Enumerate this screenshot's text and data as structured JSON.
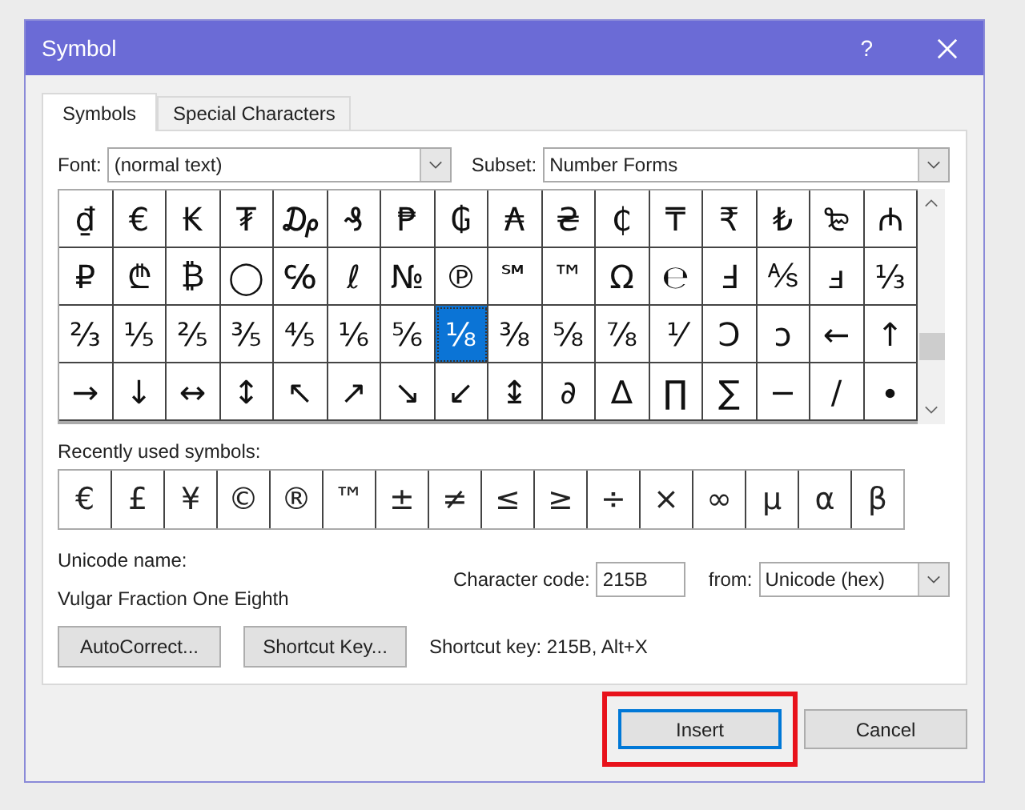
{
  "window": {
    "title": "Symbol",
    "help": "?"
  },
  "tabs": [
    {
      "label": "Symbols",
      "selected": true
    },
    {
      "label": "Special Characters",
      "selected": false
    }
  ],
  "font": {
    "label": "Font:",
    "value": "(normal text)"
  },
  "subset": {
    "label": "Subset:",
    "value": "Number Forms"
  },
  "symbols": [
    [
      {
        "char": "₫",
        "selected": false
      },
      {
        "char": "€",
        "selected": false
      },
      {
        "char": "₭",
        "selected": false
      },
      {
        "char": "₮",
        "selected": false
      },
      {
        "char": "₯",
        "selected": false
      },
      {
        "char": "₰",
        "selected": false
      },
      {
        "char": "₱",
        "selected": false
      },
      {
        "char": "₲",
        "selected": false
      },
      {
        "char": "₳",
        "selected": false
      },
      {
        "char": "₴",
        "selected": false
      },
      {
        "char": "₵",
        "selected": false
      },
      {
        "char": "₸",
        "selected": false
      },
      {
        "char": "₹",
        "selected": false
      },
      {
        "char": "₺",
        "selected": false
      },
      {
        "char": "₻",
        "selected": false
      },
      {
        "char": "₼",
        "selected": false
      }
    ],
    [
      {
        "char": "₽",
        "selected": false
      },
      {
        "char": "₾",
        "selected": false
      },
      {
        "char": "₿",
        "selected": false
      },
      {
        "char": "◯",
        "selected": false
      },
      {
        "char": "℅",
        "selected": false
      },
      {
        "char": "ℓ",
        "selected": false
      },
      {
        "char": "№",
        "selected": false
      },
      {
        "char": "℗",
        "selected": false
      },
      {
        "char": "℠",
        "selected": false
      },
      {
        "char": "™",
        "selected": false
      },
      {
        "char": "Ω",
        "selected": false
      },
      {
        "char": "℮",
        "selected": false
      },
      {
        "char": "Ⅎ",
        "selected": false
      },
      {
        "char": "⅍",
        "selected": false
      },
      {
        "char": "ⅎ",
        "selected": false
      },
      {
        "char": "⅓",
        "selected": false
      }
    ],
    [
      {
        "char": "⅔",
        "selected": false
      },
      {
        "char": "⅕",
        "selected": false
      },
      {
        "char": "⅖",
        "selected": false
      },
      {
        "char": "⅗",
        "selected": false
      },
      {
        "char": "⅘",
        "selected": false
      },
      {
        "char": "⅙",
        "selected": false
      },
      {
        "char": "⅚",
        "selected": false
      },
      {
        "char": "⅛",
        "selected": true
      },
      {
        "char": "⅜",
        "selected": false
      },
      {
        "char": "⅝",
        "selected": false
      },
      {
        "char": "⅞",
        "selected": false
      },
      {
        "char": "⅟",
        "selected": false
      },
      {
        "char": "Ↄ",
        "selected": false
      },
      {
        "char": "ↄ",
        "selected": false
      },
      {
        "char": "←",
        "selected": false
      },
      {
        "char": "↑",
        "selected": false
      }
    ],
    [
      {
        "char": "→",
        "selected": false
      },
      {
        "char": "↓",
        "selected": false
      },
      {
        "char": "↔",
        "selected": false
      },
      {
        "char": "↕",
        "selected": false
      },
      {
        "char": "↖",
        "selected": false
      },
      {
        "char": "↗",
        "selected": false
      },
      {
        "char": "↘",
        "selected": false
      },
      {
        "char": "↙",
        "selected": false
      },
      {
        "char": "↨",
        "selected": false
      },
      {
        "char": "∂",
        "selected": false
      },
      {
        "char": "∆",
        "selected": false
      },
      {
        "char": "∏",
        "selected": false
      },
      {
        "char": "∑",
        "selected": false
      },
      {
        "char": "−",
        "selected": false
      },
      {
        "char": "∕",
        "selected": false
      },
      {
        "char": "∙",
        "selected": false
      }
    ]
  ],
  "recent": {
    "label": "Recently used symbols:",
    "symbols": [
      "€",
      "£",
      "¥",
      "©",
      "®",
      "™",
      "±",
      "≠",
      "≤",
      "≥",
      "÷",
      "×",
      "∞",
      "µ",
      "α",
      "β"
    ]
  },
  "unicode_name": {
    "label": "Unicode name:",
    "value": "Vulgar Fraction One Eighth"
  },
  "character_code": {
    "label": "Character code:",
    "value": "215B"
  },
  "from": {
    "label": "from:",
    "value": "Unicode (hex)"
  },
  "autocorrect_button": "AutoCorrect...",
  "shortcut_key_button": "Shortcut Key...",
  "shortcut_key_text": "Shortcut key: 215B, Alt+X",
  "buttons": [
    {
      "label": "Insert",
      "highlighted": true
    },
    {
      "label": "Cancel",
      "highlighted": false
    }
  ]
}
